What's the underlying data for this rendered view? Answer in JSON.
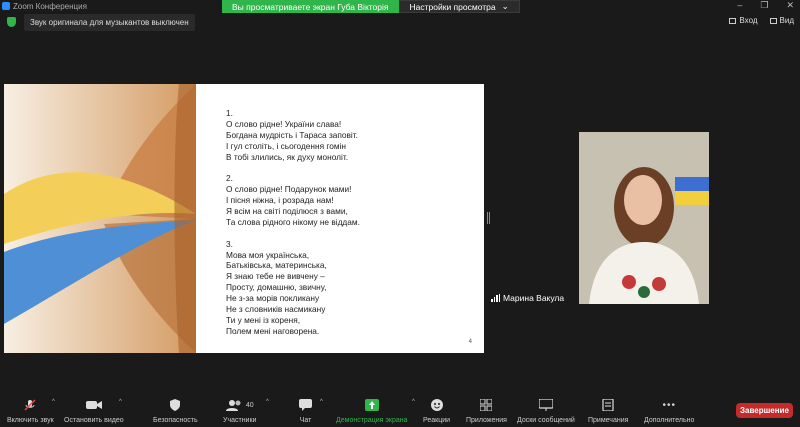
{
  "window": {
    "title": "Zoom Конференция",
    "min": "–",
    "restore": "❐",
    "close": "✕"
  },
  "share_banner": {
    "status": "Вы просматриваете экран Губа Вікторія",
    "options": "Настройки просмотра",
    "options_caret": "⌄"
  },
  "notice": "Звук оригинала для музыкантов выключен",
  "top_right": {
    "enter": "Вход",
    "view": "Вид"
  },
  "slide": {
    "stanzas": [
      [
        "1.",
        "О слово рідне! України слава!",
        "Богдана мудрість і Тараса заповіт.",
        "І гул століть, і сьогодення гомін",
        "В тобі злились, як духу моноліт."
      ],
      [
        "2.",
        "О слово рідне! Подарунок мами!",
        "І пісня ніжна, і розрада нам!",
        "Я всім на світі поділюся з вами,",
        "Та слова рідного нікому не віддам."
      ],
      [
        "3.",
        "Мова моя українська,",
        "Батьківська, материнська,",
        "Я знаю тебе не вивчену –",
        "Просту, домашню, звичну,",
        "Не з-за морів покликану",
        "Не з словників насмикану",
        "Ти у мені із кореня,",
        "Полем мені наговорена."
      ]
    ],
    "page_number": "4"
  },
  "participant": {
    "name": "Марина Вакула"
  },
  "toolbar": {
    "mute": "Включить звук",
    "video": "Остановить видео",
    "security": "Безопасность",
    "participants": "Участники",
    "participants_count": "40",
    "chat": "Чат",
    "share": "Демонстрация экрана",
    "reactions": "Реакции",
    "apps": "Приложения",
    "whiteboard": "Доски сообщений",
    "notes": "Примечания",
    "more": "Дополнительно",
    "end": "Завершение",
    "caret": "^"
  },
  "colors": {
    "accent_green": "#2fb54a",
    "end_red": "#c62b2b",
    "zoom_blue": "#2d8cff"
  }
}
